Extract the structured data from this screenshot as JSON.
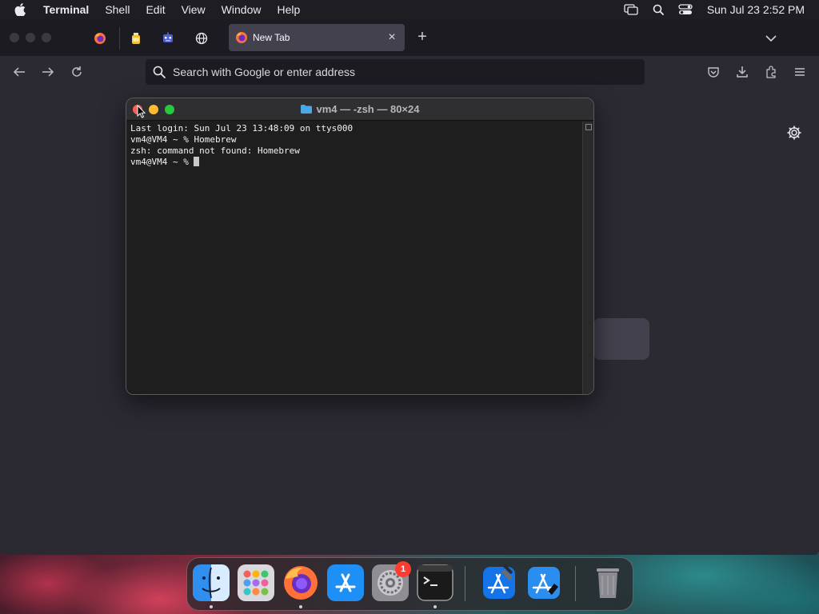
{
  "menubar": {
    "app_name": "Terminal",
    "items": [
      "Shell",
      "Edit",
      "View",
      "Window",
      "Help"
    ],
    "clock": "Sun Jul 23  2:52 PM"
  },
  "browser": {
    "active_tab": {
      "title": "New Tab"
    },
    "url_placeholder": "Search with Google or enter address"
  },
  "terminal": {
    "title": "vm4 — -zsh — 80×24",
    "lines": [
      "Last login: Sun Jul 23 13:48:09 on ttys000",
      "vm4@VM4 ~ % Homebrew",
      "zsh: command not found: Homebrew",
      "vm4@VM4 ~ % "
    ]
  },
  "dock": {
    "items": [
      "Finder",
      "Launchpad",
      "Firefox",
      "App Store",
      "System Settings",
      "Terminal",
      "Xcode",
      "Simulator",
      "Trash"
    ],
    "system_settings_badge": "1"
  },
  "colors": {
    "accent_close": "#fe5f57",
    "accent_minimize": "#febc2e",
    "accent_zoom": "#28c840",
    "badge": "#ff3b30"
  }
}
